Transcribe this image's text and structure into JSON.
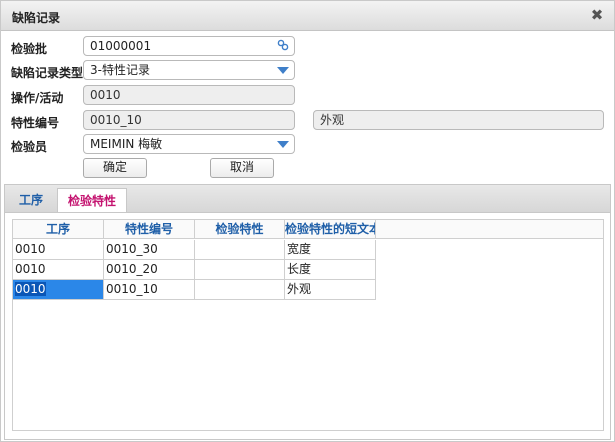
{
  "window": {
    "title": "缺陷记录",
    "close_icon": "close-icon"
  },
  "form": {
    "inspection_lot": {
      "label": "检验批",
      "value": "01000001",
      "icon": "link-icon"
    },
    "defect_record_type": {
      "label": "缺陷记录类型",
      "value": "3-特性记录"
    },
    "operation": {
      "label": "操作/活动",
      "value": "0010"
    },
    "characteristic_no": {
      "label": "特性编号",
      "value": "0010_10",
      "description": "外观"
    },
    "inspector": {
      "label": "检验员",
      "value": "MEIMIN 梅敏"
    },
    "ok_label": "确定",
    "cancel_label": "取消"
  },
  "tabs": [
    {
      "label": "工序",
      "active": false
    },
    {
      "label": "检验特性",
      "active": true
    }
  ],
  "grid": {
    "columns": [
      "工序",
      "特性编号",
      "检验特性",
      "检验特性的短文本"
    ],
    "rows": [
      [
        "0010",
        "0010_30",
        "",
        "宽度"
      ],
      [
        "0010",
        "0010_20",
        "",
        "长度"
      ],
      [
        "0010",
        "0010_10",
        "",
        "外观"
      ]
    ],
    "selected_row": 2
  },
  "colors": {
    "accent": "#1f5fa8",
    "active_tab": "#c4126f",
    "selection": "#2b87e8"
  }
}
